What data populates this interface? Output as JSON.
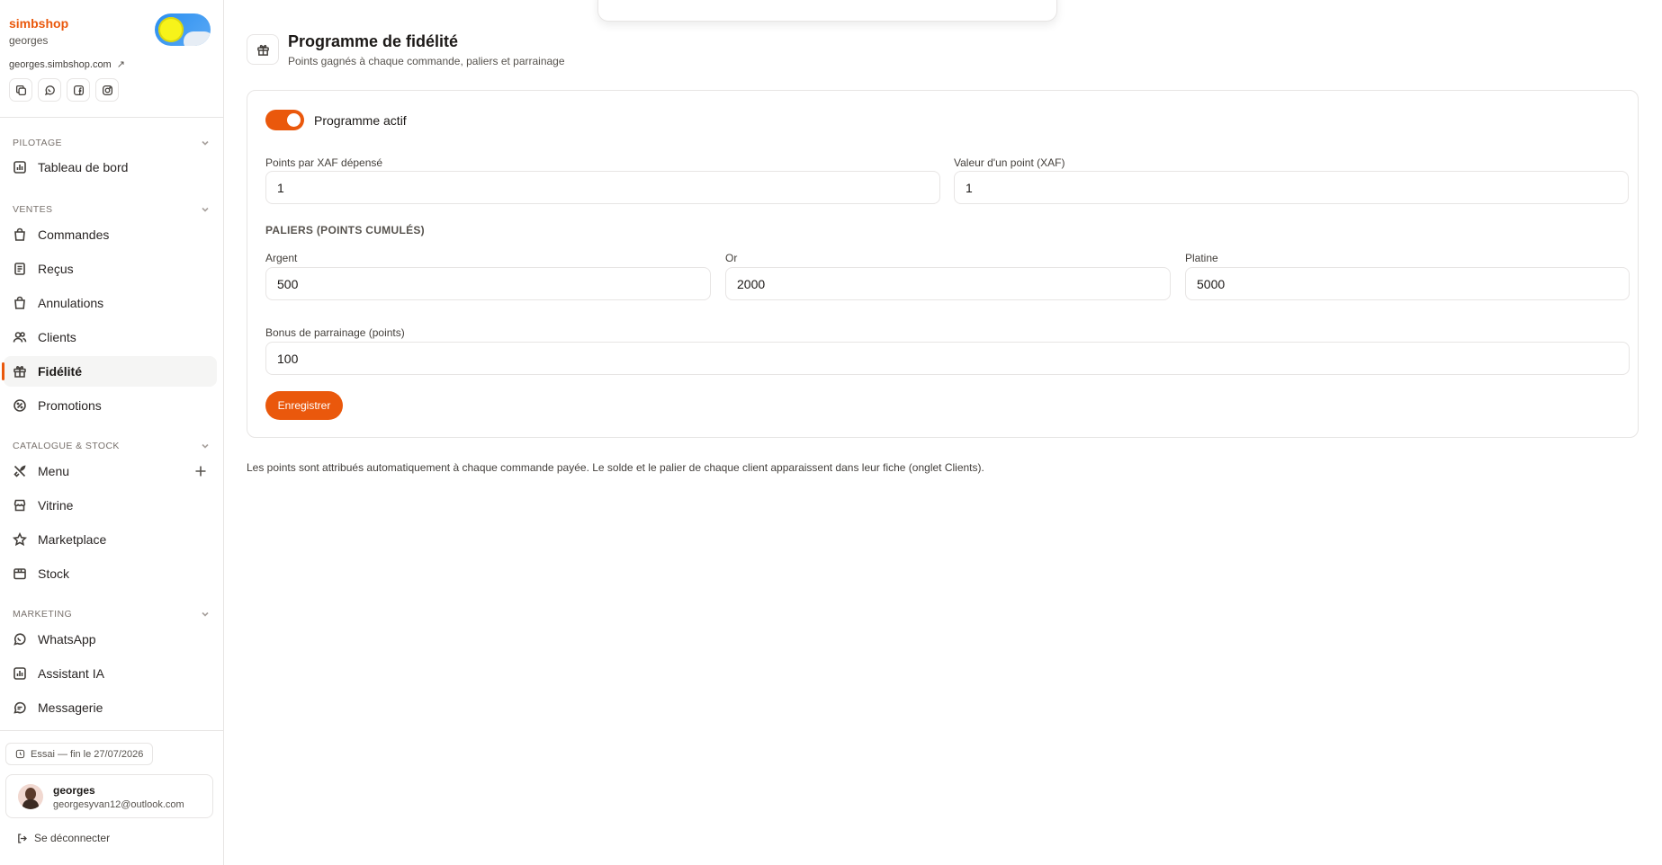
{
  "sidebar": {
    "brand_name": "simbshop",
    "brand_user": "georges",
    "shop_link": "georges.simbshop.com",
    "shop_link_icon": "↗",
    "social_icons": [
      "copy-icon",
      "whatsapp-icon",
      "facebook-icon",
      "instagram-icon"
    ],
    "sections": {
      "pilotage": "PILOTAGE",
      "ventes": "VENTES",
      "catalogue": "CATALOGUE & STOCK",
      "marketing": "MARKETING"
    },
    "items": {
      "dashboard": "Tableau de bord",
      "orders": "Commandes",
      "receipts": "Reçus",
      "cancellations": "Annulations",
      "clients": "Clients",
      "loyalty": "Fidélité",
      "promotions": "Promotions",
      "menu": "Menu",
      "storefront": "Vitrine",
      "marketplace": "Marketplace",
      "stock": "Stock",
      "whatsapp": "WhatsApp",
      "assistant": "Assistant IA",
      "messaging": "Messagerie"
    },
    "trial": "Essai — fin le 27/07/2026",
    "user": {
      "name": "georges",
      "email": "georgesyvan12@outlook.com"
    },
    "logout": "Se déconnecter"
  },
  "page": {
    "title": "Programme de fidélité",
    "subtitle": "Points gagnés à chaque commande, paliers et parrainage",
    "toggle_label": "Programme actif",
    "program_active": true,
    "points_per_xaf_label": "Points par XAF dépensé",
    "points_per_xaf": "1",
    "point_value_label": "Valeur d'un point (XAF)",
    "point_value": "1",
    "tiers_title": "PALIERS (POINTS CUMULÉS)",
    "tiers": {
      "silver_label": "Argent",
      "silver": "500",
      "gold_label": "Or",
      "gold": "2000",
      "platinum_label": "Platine",
      "platinum": "5000"
    },
    "referral_label": "Bonus de parrainage (points)",
    "referral": "100",
    "save": "Enregistrer",
    "footnote": "Les points sont attribués automatiquement à chaque commande payée. Le solde et le palier de chaque client apparaissent dans leur fiche (onglet Clients)."
  },
  "colors": {
    "accent": "#ea580c",
    "border": "#e7e5e4"
  }
}
